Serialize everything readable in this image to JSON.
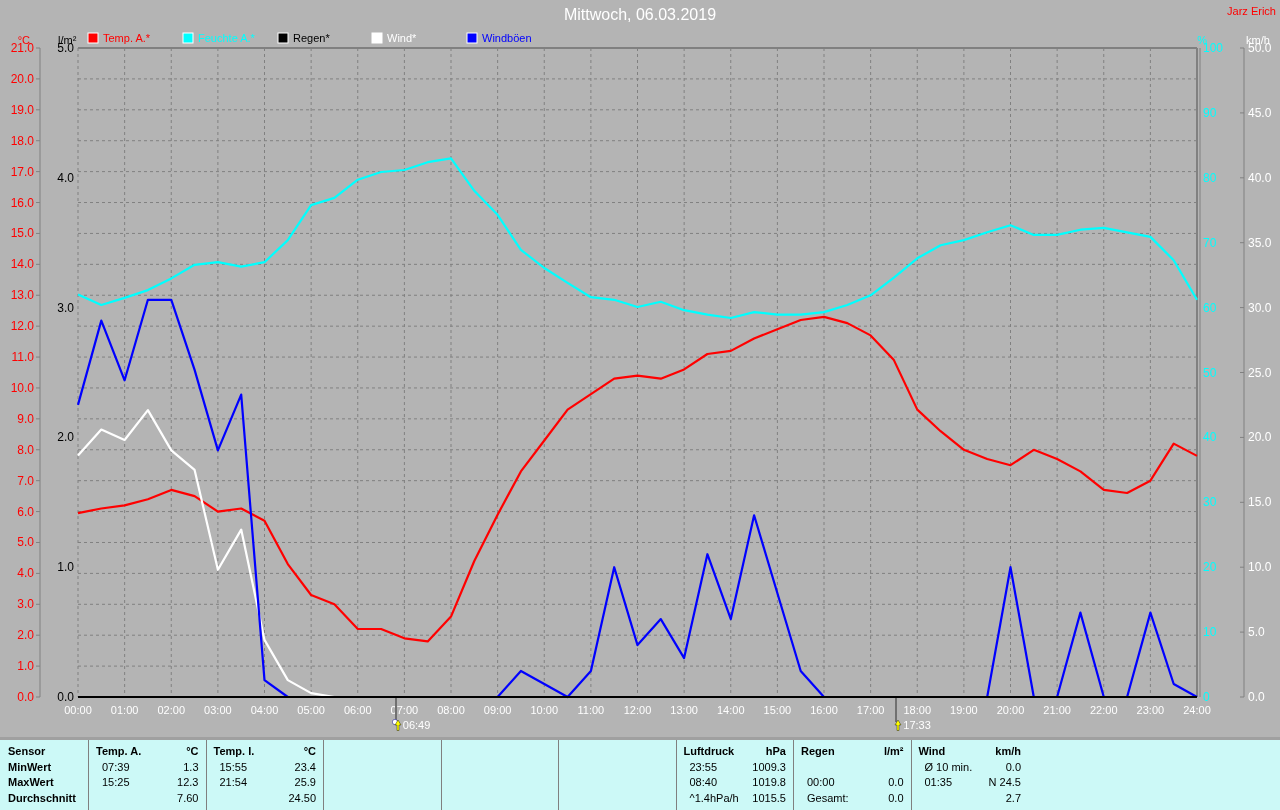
{
  "title": "Mittwoch, 06.03.2019",
  "author": "Jarz Erich",
  "chart": {
    "chart_data": {
      "type": "line",
      "x": [
        0,
        0.5,
        1,
        1.5,
        2,
        2.5,
        3,
        3.5,
        4,
        4.5,
        5,
        5.5,
        6,
        6.5,
        7,
        7.5,
        8,
        8.5,
        9,
        9.5,
        10,
        10.5,
        11,
        11.5,
        12,
        12.5,
        13,
        13.5,
        14,
        14.5,
        15,
        15.5,
        16,
        16.5,
        17,
        17.5,
        18,
        18.5,
        19,
        19.5,
        20,
        20.5,
        21,
        21.5,
        22,
        22.5,
        23,
        23.5,
        24
      ],
      "xlim": [
        0,
        24
      ],
      "xticks": [
        {
          "value": 0,
          "label": "00:00"
        },
        {
          "value": 1,
          "label": "01:00"
        },
        {
          "value": 2,
          "label": "02:00"
        },
        {
          "value": 3,
          "label": "03:00"
        },
        {
          "value": 4,
          "label": "04:00"
        },
        {
          "value": 5,
          "label": "05:00"
        },
        {
          "value": 6,
          "label": "06:00"
        },
        {
          "value": 7,
          "label": "07:00"
        },
        {
          "value": 8,
          "label": "08:00"
        },
        {
          "value": 9,
          "label": "09:00"
        },
        {
          "value": 10,
          "label": "10:00"
        },
        {
          "value": 11,
          "label": "11:00"
        },
        {
          "value": 12,
          "label": "12:00"
        },
        {
          "value": 13,
          "label": "13:00"
        },
        {
          "value": 14,
          "label": "14:00"
        },
        {
          "value": 15,
          "label": "15:00"
        },
        {
          "value": 16,
          "label": "16:00"
        },
        {
          "value": 17,
          "label": "17:00"
        },
        {
          "value": 18,
          "label": "18:00"
        },
        {
          "value": 19,
          "label": "19:00"
        },
        {
          "value": 20,
          "label": "20:00"
        },
        {
          "value": 21,
          "label": "21:00"
        },
        {
          "value": 22,
          "label": "22:00"
        },
        {
          "value": 23,
          "label": "23:00"
        },
        {
          "value": 24,
          "label": "24:00"
        }
      ],
      "ylabel": "°C",
      "ylim": [
        0,
        21
      ],
      "yticks": [
        {
          "value": 0,
          "label": "0.0"
        },
        {
          "value": 1,
          "label": "1.0"
        },
        {
          "value": 2,
          "label": "2.0"
        },
        {
          "value": 3,
          "label": "3.0"
        },
        {
          "value": 4,
          "label": "4.0"
        },
        {
          "value": 5,
          "label": "5.0"
        },
        {
          "value": 6,
          "label": "6.0"
        },
        {
          "value": 7,
          "label": "7.0"
        },
        {
          "value": 8,
          "label": "8.0"
        },
        {
          "value": 9,
          "label": "9.0"
        },
        {
          "value": 10,
          "label": "10.0"
        },
        {
          "value": 11,
          "label": "11.0"
        },
        {
          "value": 12,
          "label": "12.0"
        },
        {
          "value": 13,
          "label": "13.0"
        },
        {
          "value": 14,
          "label": "14.0"
        },
        {
          "value": 15,
          "label": "15.0"
        },
        {
          "value": 16,
          "label": "16.0"
        },
        {
          "value": 17,
          "label": "17.0"
        },
        {
          "value": 18,
          "label": "18.0"
        },
        {
          "value": 19,
          "label": "19.0"
        },
        {
          "value": 20,
          "label": "20.0"
        },
        {
          "value": 21,
          "label": "21.0"
        }
      ],
      "y3label": "%",
      "y3lim": [
        0,
        100
      ],
      "y3ticks": [
        {
          "value": 0,
          "label": "0"
        },
        {
          "value": 10,
          "label": "10"
        },
        {
          "value": 20,
          "label": "20"
        },
        {
          "value": 30,
          "label": "30"
        },
        {
          "value": 40,
          "label": "40"
        },
        {
          "value": 50,
          "label": "50"
        },
        {
          "value": 60,
          "label": "60"
        },
        {
          "value": 70,
          "label": "70"
        },
        {
          "value": 80,
          "label": "80"
        },
        {
          "value": 90,
          "label": "90"
        },
        {
          "value": 100,
          "label": "100"
        }
      ],
      "y2label": "km/h",
      "y2lim": [
        0,
        50
      ],
      "y2ticks": [
        {
          "value": 0,
          "label": "0.0"
        },
        {
          "value": 5,
          "label": "5.0"
        },
        {
          "value": 10,
          "label": "10.0"
        },
        {
          "value": 15,
          "label": "15.0"
        },
        {
          "value": 20,
          "label": "20.0"
        },
        {
          "value": 25,
          "label": "25.0"
        },
        {
          "value": 30,
          "label": "30.0"
        },
        {
          "value": 35,
          "label": "35.0"
        },
        {
          "value": 40,
          "label": "40.0"
        },
        {
          "value": 45,
          "label": "45.0"
        },
        {
          "value": 50,
          "label": "50.0"
        }
      ],
      "series": [
        {
          "name": "Temp. A.*",
          "color": "#ff0000",
          "values": [
            5.95,
            6.1,
            6.2,
            6.4,
            6.7,
            6.5,
            6.0,
            6.1,
            5.7,
            4.3,
            3.3,
            3.0,
            2.2,
            2.2,
            1.9,
            1.8,
            2.6,
            4.4,
            5.9,
            7.3,
            8.3,
            9.3,
            9.8,
            10.3,
            10.4,
            10.3,
            10.6,
            11.1,
            11.2,
            11.6,
            11.9,
            12.2,
            12.3,
            12.1,
            11.7,
            10.9,
            9.3,
            8.6,
            8.0,
            7.7,
            7.5,
            8.0,
            7.7,
            7.3,
            6.7,
            6.6,
            7.0,
            8.2,
            7.8
          ]
        },
        {
          "name": "Feuchte A.*",
          "color": "#00ffff",
          "axis": "y3",
          "values": [
            62,
            60.4,
            61.5,
            62.7,
            64.5,
            66.6,
            67,
            66.3,
            67,
            70.4,
            75.8,
            76.9,
            79.7,
            80.9,
            81.2,
            82.4,
            83,
            78,
            74.3,
            68.9,
            66.1,
            63.8,
            61.6,
            61.2,
            60.1,
            60.9,
            59.6,
            58.9,
            58.4,
            59.3,
            58.9,
            58.9,
            59.3,
            60.4,
            61.9,
            64.6,
            67.6,
            69.6,
            70.4,
            71.6,
            72.7,
            71.2,
            71.2,
            72,
            72.3,
            71.6,
            70.9,
            67.3,
            61.2
          ]
        },
        {
          "name": "Regen*",
          "color": "#000000",
          "values": [
            0,
            0,
            0,
            0,
            0,
            0,
            0,
            0,
            0,
            0,
            0,
            0,
            0,
            0,
            0,
            0,
            0,
            0,
            0,
            0,
            0,
            0,
            0,
            0,
            0,
            0,
            0,
            0,
            0,
            0,
            0,
            0,
            0,
            0,
            0,
            0,
            0,
            0,
            0,
            0,
            0,
            0,
            0,
            0,
            0,
            0,
            0,
            0,
            0
          ]
        },
        {
          "name": "Wind*",
          "color": "#ffffff",
          "axis": "y2",
          "values": [
            18.6,
            20.6,
            19.8,
            22.1,
            19.0,
            17.5,
            9.8,
            12.9,
            4.4,
            1.3,
            0.3,
            0,
            null,
            null,
            null,
            null,
            null,
            null,
            null,
            null,
            null,
            null,
            null,
            null,
            null,
            null,
            null,
            null,
            null,
            null,
            null,
            null,
            null,
            null,
            null,
            null,
            null,
            null,
            null,
            null,
            null,
            null,
            null,
            null,
            null,
            null,
            null,
            null,
            null
          ]
        },
        {
          "name": "Windböen",
          "color": "#0000ff",
          "axis": "y2",
          "values": [
            22.5,
            29.0,
            24.4,
            30.6,
            30.6,
            25.2,
            19.0,
            23.3,
            1.3,
            0,
            0,
            0,
            0,
            0,
            0,
            0,
            0,
            0,
            0,
            2,
            1,
            0,
            2,
            10,
            4,
            6,
            3,
            11,
            6,
            14,
            8,
            2,
            0,
            0,
            0,
            0,
            0,
            0,
            0,
            0,
            10,
            0,
            0,
            6.5,
            0,
            0,
            6.5,
            1,
            0
          ]
        }
      ],
      "grid": true,
      "legend": "top"
    },
    "sun_markers": [
      {
        "kind": "sunrise",
        "time": "06:49"
      },
      {
        "kind": "sunset",
        "time": "17:33"
      }
    ],
    "rain_axis": {
      "label": "l/m²",
      "ticks": [
        "5.0",
        "4.0",
        "3.0",
        "2.0",
        "1.0",
        "0.0"
      ]
    }
  },
  "table": {
    "columns": [
      {
        "kind": "labels",
        "header": [
          "Sensor"
        ],
        "rows": [
          [
            "MinWert"
          ],
          [
            "MaxWert"
          ],
          [
            "Durchschnitt"
          ]
        ]
      },
      {
        "kind": "data",
        "header": [
          "Temp. A.",
          "°C"
        ],
        "rows": [
          [
            "07:39",
            "1.3"
          ],
          [
            "15:25",
            "12.3"
          ],
          [
            null,
            "7.60"
          ]
        ]
      },
      {
        "kind": "data",
        "header": [
          "Temp. I.",
          "°C"
        ],
        "rows": [
          [
            "15:55",
            "23.4"
          ],
          [
            "21:54",
            "25.9"
          ],
          [
            null,
            "24.50"
          ]
        ]
      },
      {
        "kind": "blank"
      },
      {
        "kind": "blank"
      },
      {
        "kind": "blank"
      },
      {
        "kind": "data",
        "header": [
          "Luftdruck",
          "hPa"
        ],
        "rows": [
          [
            "23:55",
            "1009.3"
          ],
          [
            "08:40",
            "1019.8"
          ],
          [
            "^1.4hPa/h",
            "1015.5"
          ]
        ]
      },
      {
        "kind": "data",
        "header": [
          "Regen",
          "l/m²"
        ],
        "rows": [
          [
            null,
            null
          ],
          [
            "00:00",
            "0.0"
          ],
          [
            "Gesamt:",
            "0.0"
          ]
        ]
      },
      {
        "kind": "data",
        "header": [
          "Wind",
          "km/h"
        ],
        "rows": [
          [
            "Ø 10 min.",
            "0.0"
          ],
          [
            "01:35",
            "N 24.5"
          ],
          [
            null,
            "2.7"
          ]
        ]
      }
    ]
  }
}
